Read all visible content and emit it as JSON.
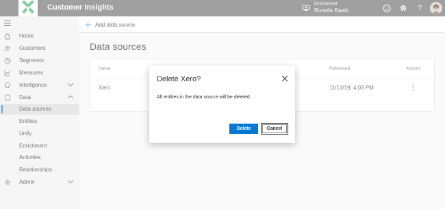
{
  "app": {
    "title": "Customer Insights"
  },
  "environment": {
    "label": "Environment",
    "name": "Ronelle Raath"
  },
  "topbar_icons": [
    "environment-icon",
    "smiley-icon",
    "gear-icon",
    "help-icon"
  ],
  "help_glyph": "?",
  "sidebar": {
    "items": [
      {
        "label": "Home",
        "icon": "home-icon"
      },
      {
        "label": "Customers",
        "icon": "customers-icon"
      },
      {
        "label": "Segments",
        "icon": "segments-icon"
      },
      {
        "label": "Measures",
        "icon": "measures-icon"
      },
      {
        "label": "Intelligence",
        "icon": "intelligence-icon",
        "expandable": true
      },
      {
        "label": "Data",
        "icon": "data-icon",
        "expanded": true
      },
      {
        "label": "Data sources",
        "active": true
      },
      {
        "label": "Entities"
      },
      {
        "label": "Unify"
      },
      {
        "label": "Enrichment"
      },
      {
        "label": "Activities"
      },
      {
        "label": "Relationships"
      },
      {
        "label": "Admin",
        "icon": "admin-icon",
        "expandable": true
      }
    ]
  },
  "commandbar": {
    "add_label": "Add data source"
  },
  "page": {
    "title": "Data sources"
  },
  "table": {
    "headers": {
      "name": "Name",
      "refreshed": "Refreshed",
      "actions": "Actions"
    },
    "rows": [
      {
        "name": "Xero",
        "refreshed": "11/13/19, 4:03 PM"
      }
    ]
  },
  "dialog": {
    "title": "Delete Xero?",
    "message": "All entities in the data source will be deleted.",
    "primary_label": "Delete",
    "secondary_label": "Cancel"
  },
  "colors": {
    "topbar": "#6e6e6e",
    "accent": "#0078d4",
    "logo_green": "#3bb56e"
  }
}
